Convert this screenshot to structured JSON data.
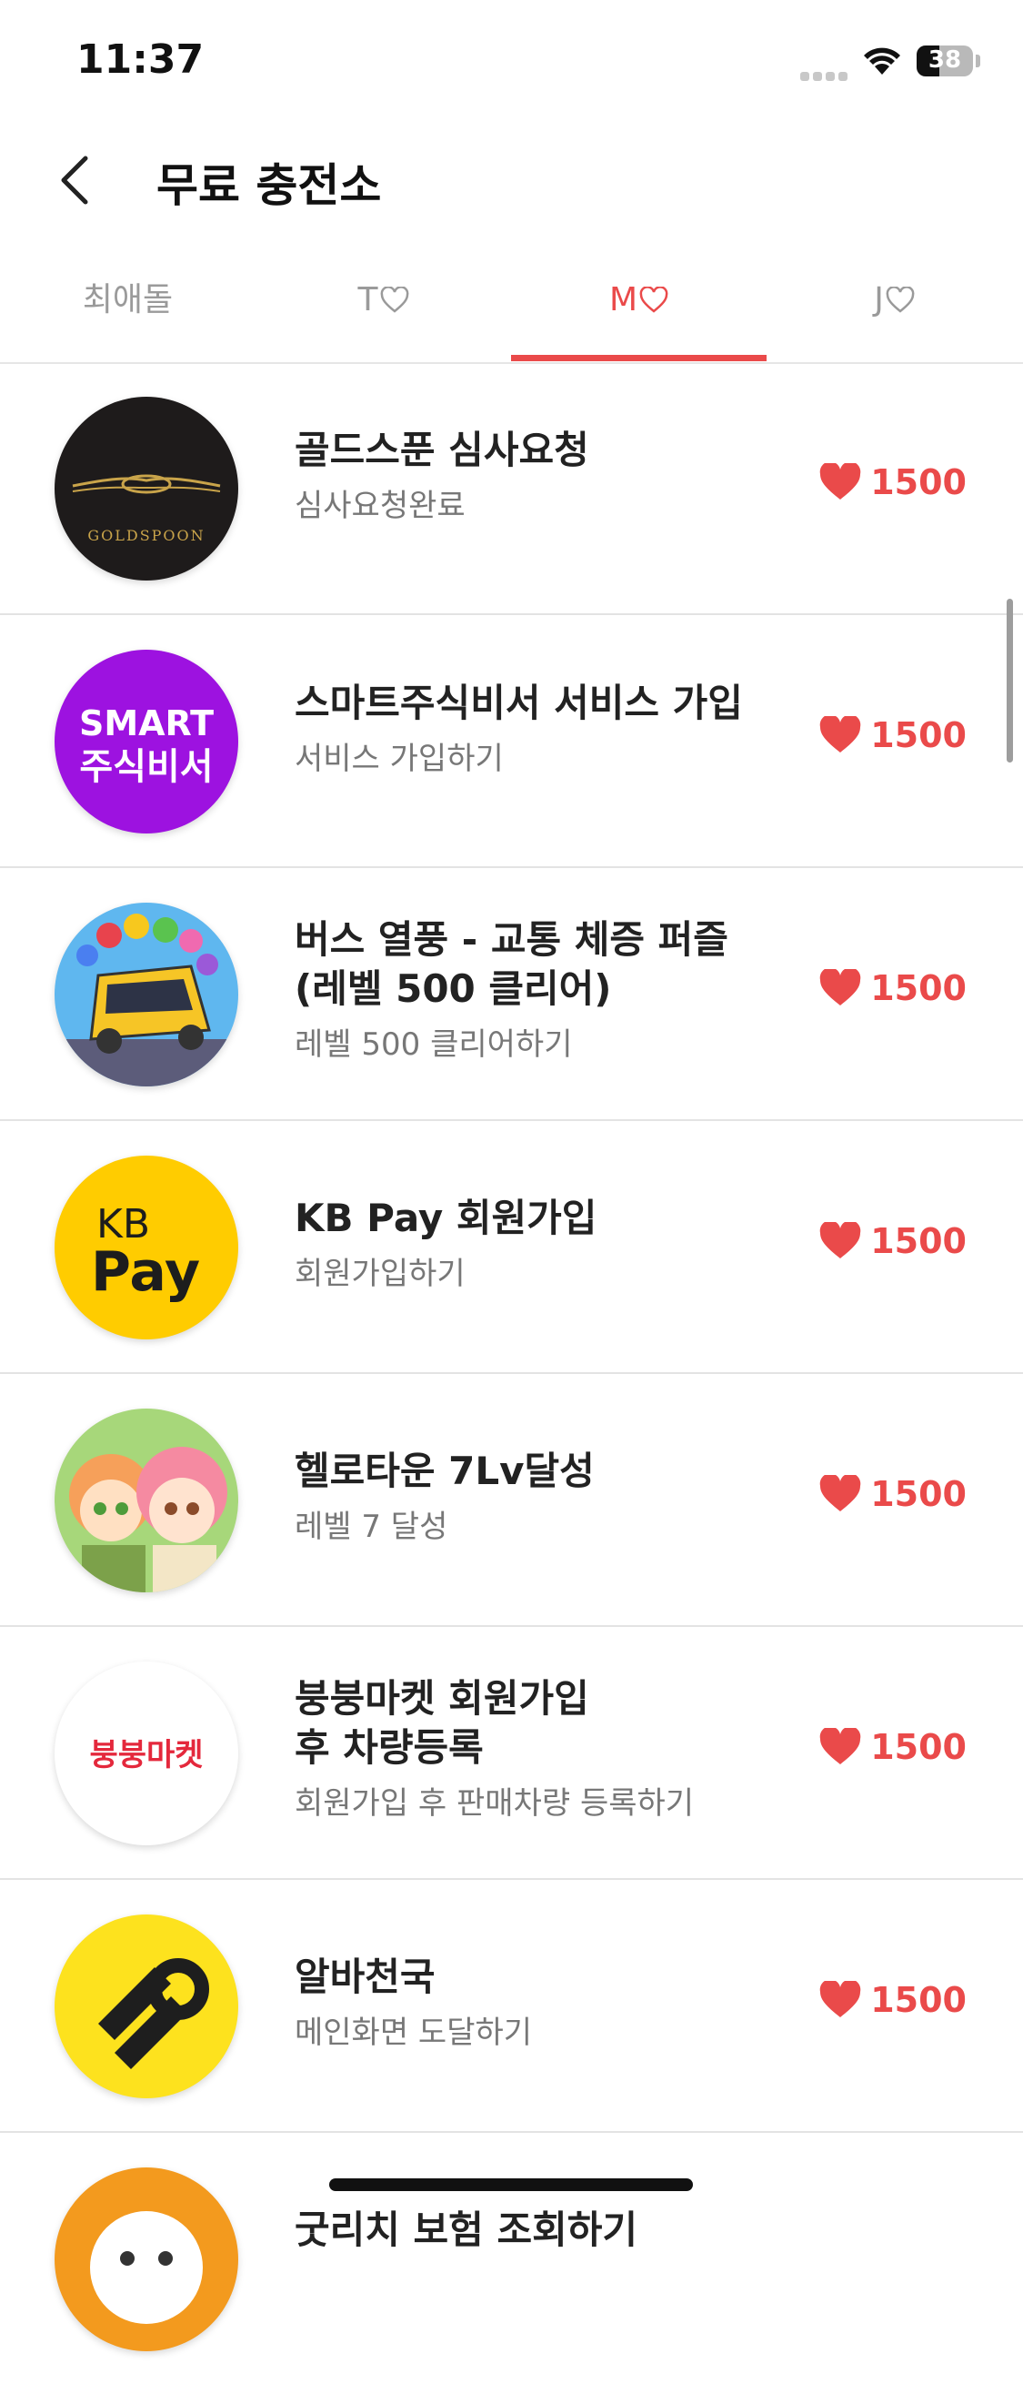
{
  "status": {
    "time": "11:37",
    "battery": "38"
  },
  "header": {
    "title": "무료 충전소"
  },
  "tabs": [
    {
      "label": "최애돌",
      "heart": false
    },
    {
      "label": "T",
      "heart": true
    },
    {
      "label": "M",
      "heart": true
    },
    {
      "label": "J",
      "heart": true
    }
  ],
  "items": [
    {
      "title": "골드스푼 심사요청",
      "subtitle": "심사요청완료",
      "reward": "1500",
      "icon": "goldspoon-logo",
      "logo_text": "GOLDSPOON"
    },
    {
      "title": "스마트주식비서 서비스 가입",
      "subtitle": "서비스 가입하기",
      "reward": "1500",
      "icon": "smart-stock-logo",
      "logo_line1": "SMART",
      "logo_line2": "주식비서"
    },
    {
      "title": "버스 열풍 - 교통 체증 퍼즐\n(레벨 500 클리어)",
      "title_line1": "버스 열풍 - 교통 체증 퍼즐",
      "title_line2": "(레벨 500 클리어)",
      "subtitle": "레벨 500 클리어하기",
      "reward": "1500",
      "icon": "bus-game-logo"
    },
    {
      "title": "KB Pay 회원가입",
      "subtitle": "회원가입하기",
      "reward": "1500",
      "icon": "kbpay-logo",
      "logo_line1": "KB",
      "logo_line2": "Pay"
    },
    {
      "title": "헬로타운 7Lv달성",
      "subtitle": "레벨 7 달성",
      "reward": "1500",
      "icon": "hellotown-logo"
    },
    {
      "title_line1": "붕붕마켓 회원가입",
      "title_line2": "후 차량등록",
      "subtitle": "회원가입 후 판매차량 등록하기",
      "reward": "1500",
      "icon": "bungbung-market-logo",
      "logo_text": "붕붕마켓"
    },
    {
      "title": "알바천국",
      "subtitle": "메인화면 도달하기",
      "reward": "1500",
      "icon": "albachunguk-logo"
    },
    {
      "title": "굿리치 보험 조회하기",
      "icon": "goodrich-logo"
    }
  ],
  "colors": {
    "accent": "#ea4a4a",
    "gold": "#c9a44a",
    "purple": "#9d12e0",
    "kb_yellow": "#ffcc00",
    "alba_yellow": "#fde21e"
  }
}
